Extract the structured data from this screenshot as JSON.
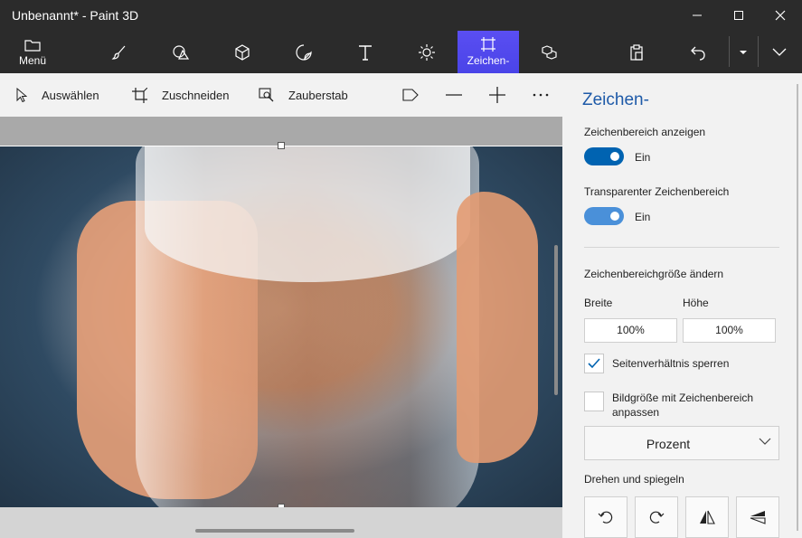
{
  "window": {
    "title": "Unbenannt* - Paint 3D",
    "controls": [
      "minimize-icon",
      "maximize-icon",
      "close-icon"
    ]
  },
  "toolbar": {
    "menu_label": "Menü",
    "canvas_label": "Zeichen-",
    "tools": [
      "brush-icon",
      "shapes-2d-icon",
      "shapes-3d-icon",
      "stickers-icon",
      "text-icon",
      "effects-icon",
      "canvas-icon",
      "library-3d-icon"
    ],
    "right_tools": [
      "paste-icon",
      "undo-icon",
      "dropdown-icon",
      "expand-icon"
    ],
    "accent_color": "#4c4cf0"
  },
  "subtoolbar": {
    "select_label": "Auswählen",
    "crop_label": "Zuschneiden",
    "magic_label": "Zauberstab",
    "extra_icons": [
      "flag-icon",
      "zoom-out-icon",
      "zoom-in-icon",
      "more-icon"
    ]
  },
  "panel": {
    "title": "Zeichen-",
    "show_canvas_label": "Zeichenbereich anzeigen",
    "show_canvas_state": "Ein",
    "transparent_label": "Transparenter Zeichenbereich",
    "transparent_state": "Ein",
    "resize_label": "Zeichenbereichgröße ändern",
    "width_label": "Breite",
    "height_label": "Höhe",
    "width_value": "100%",
    "height_value": "100%",
    "lock_label": "Seitenverhältnis sperren",
    "lock_checked": true,
    "resize_image_label_1": "Bildgröße mit Zeichenbereich",
    "resize_image_label_2": "anpassen",
    "resize_image_checked": false,
    "unit_value": "Prozent",
    "rotate_label": "Drehen und spiegeln",
    "rotate_buttons": [
      "rotate-left-icon",
      "rotate-right-icon",
      "flip-horizontal-icon",
      "flip-vertical-icon"
    ],
    "toggle_on_color": "#0063b1",
    "toggle_transparent_color": "#4a90d9",
    "title_color": "#1e5aa8"
  }
}
